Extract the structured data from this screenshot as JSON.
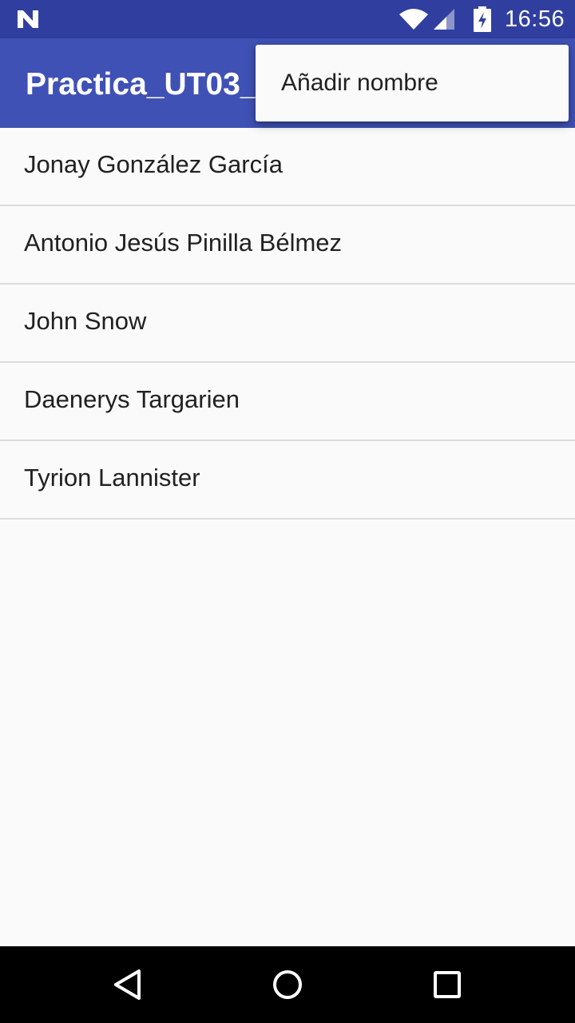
{
  "status_bar": {
    "time": "16:56",
    "icons": [
      "n-notification-icon",
      "wifi-icon",
      "signal-icon",
      "battery-charging-icon"
    ]
  },
  "app_bar": {
    "title": "Practica_UT03_Listas",
    "background": "#3f51b5"
  },
  "list": {
    "items": [
      "Jonay González García",
      "Antonio Jesús Pinilla Bélmez",
      "John Snow",
      "Daenerys Targarien",
      "Tyrion Lannister"
    ]
  },
  "overflow_menu": {
    "items": [
      "Añadir nombre"
    ]
  },
  "nav_bar": {
    "buttons": [
      "back-icon",
      "home-icon",
      "recents-icon"
    ]
  },
  "colors": {
    "status_bar": "#303f9f",
    "app_bar": "#3f51b5",
    "background": "#fafafa",
    "divider": "#dcdcdc"
  }
}
